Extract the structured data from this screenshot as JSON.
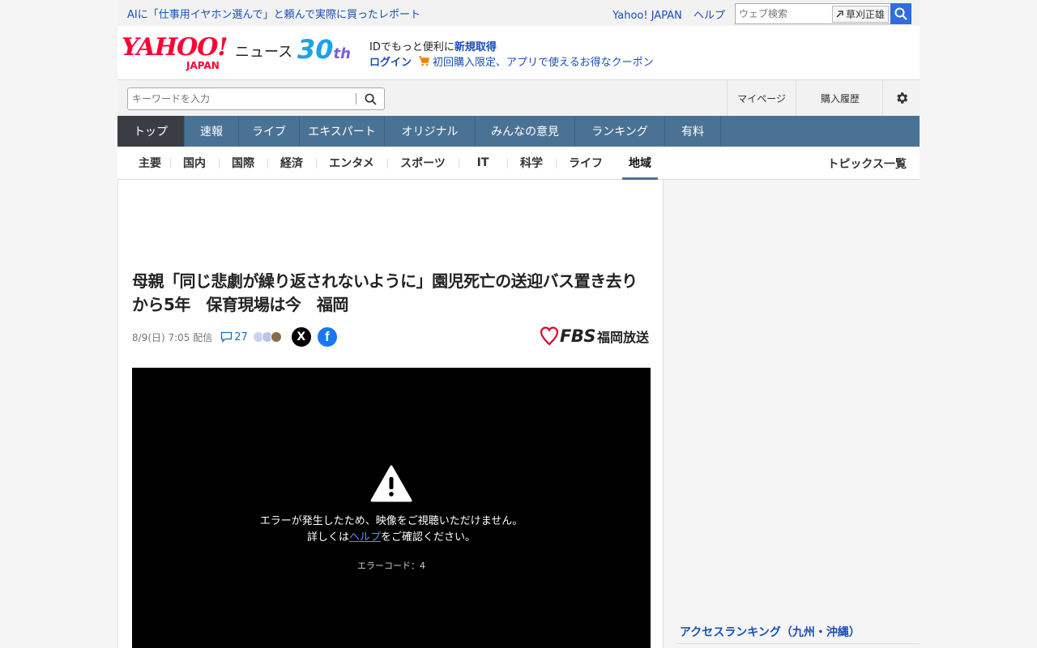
{
  "topbar": {
    "promo": "AIに「仕事用イヤホン選んで」と頼んで実際に買ったレポート",
    "links": [
      "Yahoo! JAPAN",
      "ヘルプ"
    ],
    "websearch_placeholder": "ウェブ検索",
    "tag_chip": "草刈正雄"
  },
  "header": {
    "logo_yahoo": "YAHOO!",
    "logo_japan": "JAPAN",
    "logo_news": "ニュース",
    "logo_30": "30",
    "logo_th": "th",
    "id_text": "IDでもっと便利に",
    "id_signup": "新規取得",
    "login": "ログイン",
    "coupon": "初回購入限定、アプリで使えるお得なクーポン"
  },
  "search": {
    "placeholder": "キーワードを入力",
    "mypage": "マイページ",
    "history": "購入履歴"
  },
  "nav": {
    "tabs": [
      "トップ",
      "速報",
      "ライブ",
      "エキスパート",
      "オリジナル",
      "みんなの意見",
      "ランキング",
      "有料"
    ]
  },
  "subnav": {
    "items": [
      "主要",
      "国内",
      "国際",
      "経済",
      "エンタメ",
      "スポーツ",
      "IT",
      "科学",
      "ライフ",
      "地域"
    ],
    "topics": "トピックス一覧"
  },
  "article": {
    "headline": "母親「同じ悲劇が繰り返されないように」園児死亡の送迎バス置き去りから5年　保育現場は今　福岡",
    "date": "8/9(日) 7:05 配信",
    "comment_count": "27",
    "publisher_logo": "FBS",
    "publisher_name": "福岡放送",
    "video_error_line1": "エラーが発生したため、映像をご視聴いただけません。",
    "video_error_line2_pre": "詳しくは",
    "video_error_link": "ヘルプ",
    "video_error_line2_post": "をご確認ください。",
    "video_error_code": "エラーコード：4"
  },
  "sidebar": {
    "ranking_title": "アクセスランキング（九州・沖縄）"
  },
  "colors": {
    "nav_bg": "#4a7294",
    "nav_active": "#3a3e44",
    "link_blue": "#1a4fb5",
    "yahoo_red": "#ff0033"
  }
}
